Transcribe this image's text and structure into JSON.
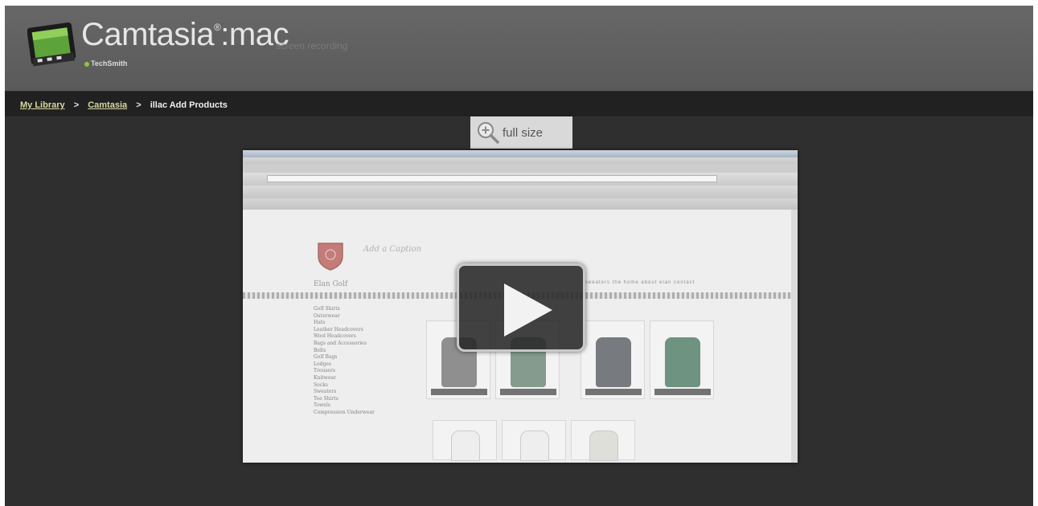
{
  "header": {
    "brand": "Camtasia",
    "brand_suffix": ":mac",
    "brand_trademark": "®",
    "brand_sub": "screen recording",
    "vendor": "TechSmith"
  },
  "breadcrumb": {
    "items": [
      "My Library",
      "Camtasia"
    ],
    "separator": ">",
    "current": "illac Add Products"
  },
  "fullsize": {
    "label": "full size"
  },
  "video": {
    "header_script": "Add a Caption",
    "brand": "Elan Golf",
    "nav": "sweaters   the home   about elan   contact",
    "categories": [
      "Golf Shirts",
      "Outerwear",
      "Hats",
      "Leather Headcovers",
      "Wool Headcovers",
      "Bags and Accessories",
      "Belts",
      "Golf Bags",
      "Lodges",
      "Trousers",
      "Knitwear",
      "Socks",
      "Sweaters",
      "Tee Shirts",
      "Towels",
      "Compression Underwear"
    ]
  },
  "colors": {
    "header": "#5f5f5f",
    "body": "#2f2f2f",
    "crumb_bar": "#212121",
    "crumb_link": "#d8d9a0"
  }
}
